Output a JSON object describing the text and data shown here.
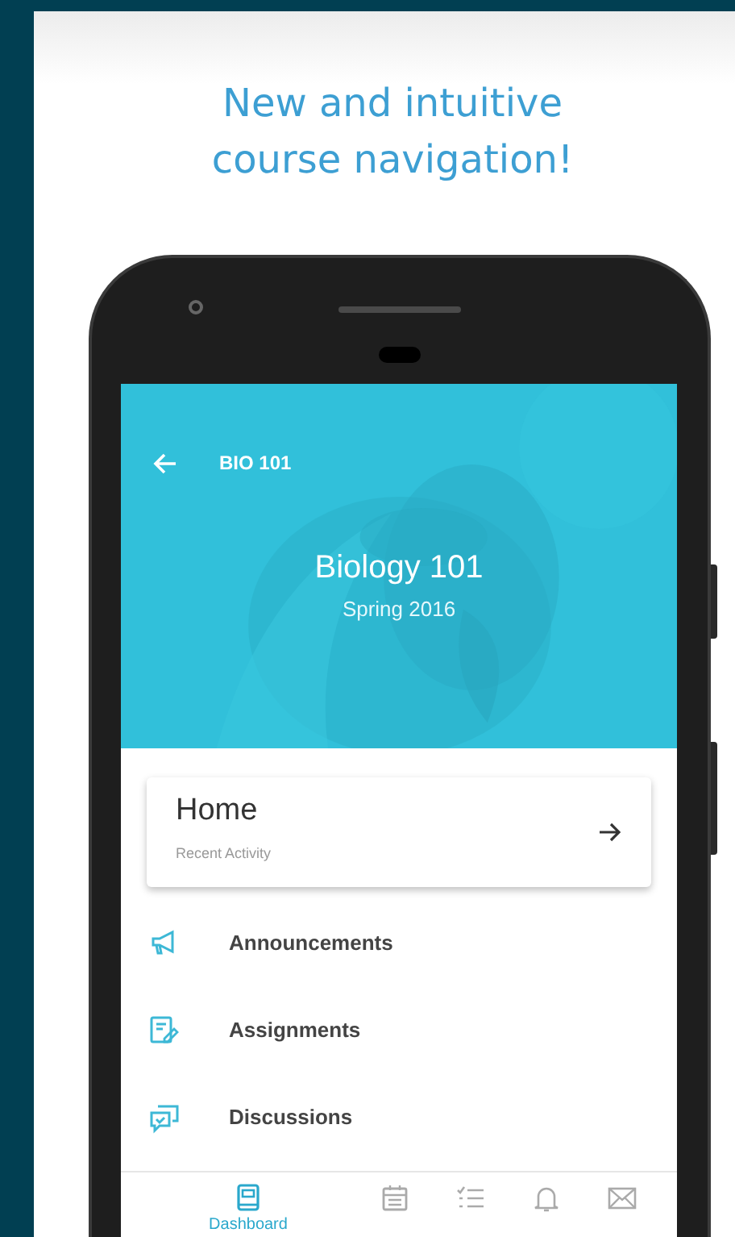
{
  "headline": "New and intuitive course navigation!",
  "app_bar": {
    "title": "BIO 101"
  },
  "course": {
    "name": "Biology 101",
    "term": "Spring 2016"
  },
  "home_card": {
    "title": "Home",
    "subtitle": "Recent Activity"
  },
  "menu": [
    {
      "kind": "announcements",
      "label": "Announcements"
    },
    {
      "kind": "assignments",
      "label": "Assignments"
    },
    {
      "kind": "discussions",
      "label": "Discussions"
    }
  ],
  "bottom_nav": [
    {
      "kind": "dashboard",
      "label": "Dashboard",
      "selected": true
    },
    {
      "kind": "calendar",
      "selected": false
    },
    {
      "kind": "todo",
      "selected": false
    },
    {
      "kind": "notifications",
      "selected": false
    },
    {
      "kind": "inbox",
      "selected": false
    }
  ]
}
